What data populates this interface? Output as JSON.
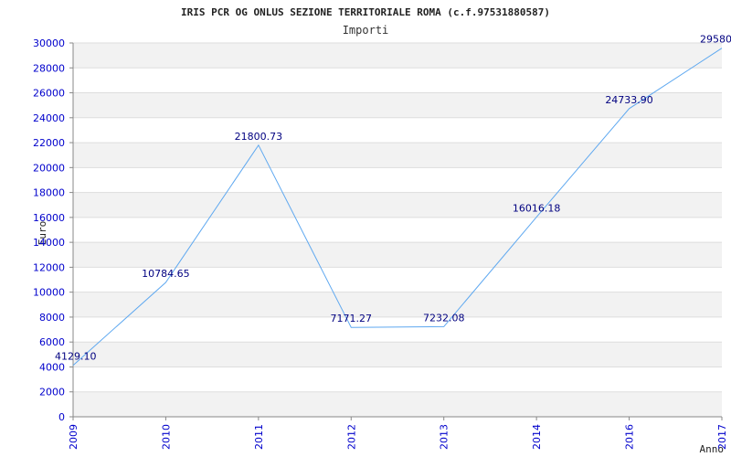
{
  "chart_data": {
    "type": "line",
    "title": "IRIS PCR OG ONLUS SEZIONE TERRITORIALE ROMA (c.f.97531880587)",
    "subtitle": "Importi",
    "ylabel": "Euro",
    "xlabel": "Anno",
    "categories": [
      "2009",
      "2010",
      "2011",
      "2012",
      "2013",
      "2014",
      "2016",
      "2017"
    ],
    "values": [
      4129.1,
      10784.65,
      21800.73,
      7171.27,
      7232.08,
      16016.18,
      24733.9,
      29580.0
    ],
    "value_labels": [
      "4129.10",
      "10784.65",
      "21800.73",
      "7171.27",
      "7232.08",
      "16016.18",
      "24733.90",
      "29580."
    ],
    "ylim": [
      0,
      30000
    ],
    "yticks": [
      "0",
      "2000",
      "4000",
      "6000",
      "8000",
      "10000",
      "12000",
      "14000",
      "16000",
      "18000",
      "20000",
      "22000",
      "24000",
      "26000",
      "28000",
      "30000"
    ],
    "grid": true,
    "line_color": "#5ea8f0",
    "tick_color": "#0000cc",
    "band_color": "#f2f2f2"
  }
}
